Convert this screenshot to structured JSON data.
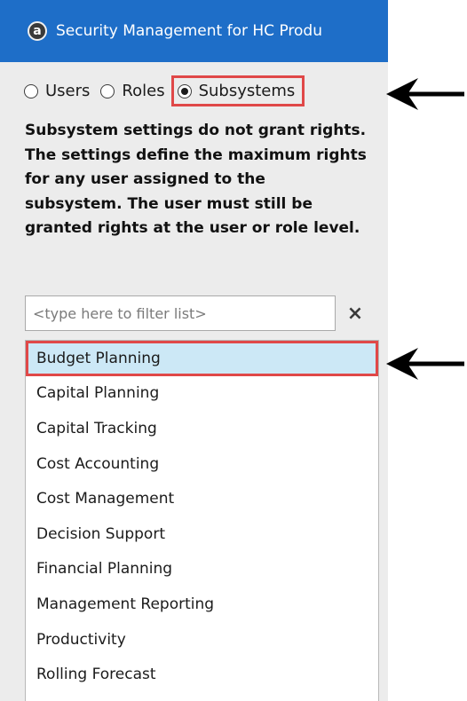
{
  "window": {
    "app_icon_letter": "a",
    "title": "Security Management for HC Produ"
  },
  "mode_selector": {
    "options": [
      {
        "label": "Users",
        "selected": false
      },
      {
        "label": "Roles",
        "selected": false
      },
      {
        "label": "Subsystems",
        "selected": true
      }
    ]
  },
  "notice": "Subsystem settings do not grant rights. The settings define the maximum rights for any user assigned to the subsystem. The user must still be granted rights at the user or role level.",
  "filter": {
    "placeholder": "<type here to filter list>",
    "clear_icon": "×"
  },
  "subsystems": [
    "Budget Planning",
    "Capital Planning",
    "Capital Tracking",
    "Cost Accounting",
    "Cost Management",
    "Decision Support",
    "Financial Planning",
    "Management Reporting",
    "Productivity",
    "Rolling Forecast"
  ],
  "selected_subsystem": "Budget Planning",
  "colors": {
    "titlebar": "#1e6ec8",
    "highlight_outline": "#e04848",
    "selection": "#cce8f6"
  }
}
